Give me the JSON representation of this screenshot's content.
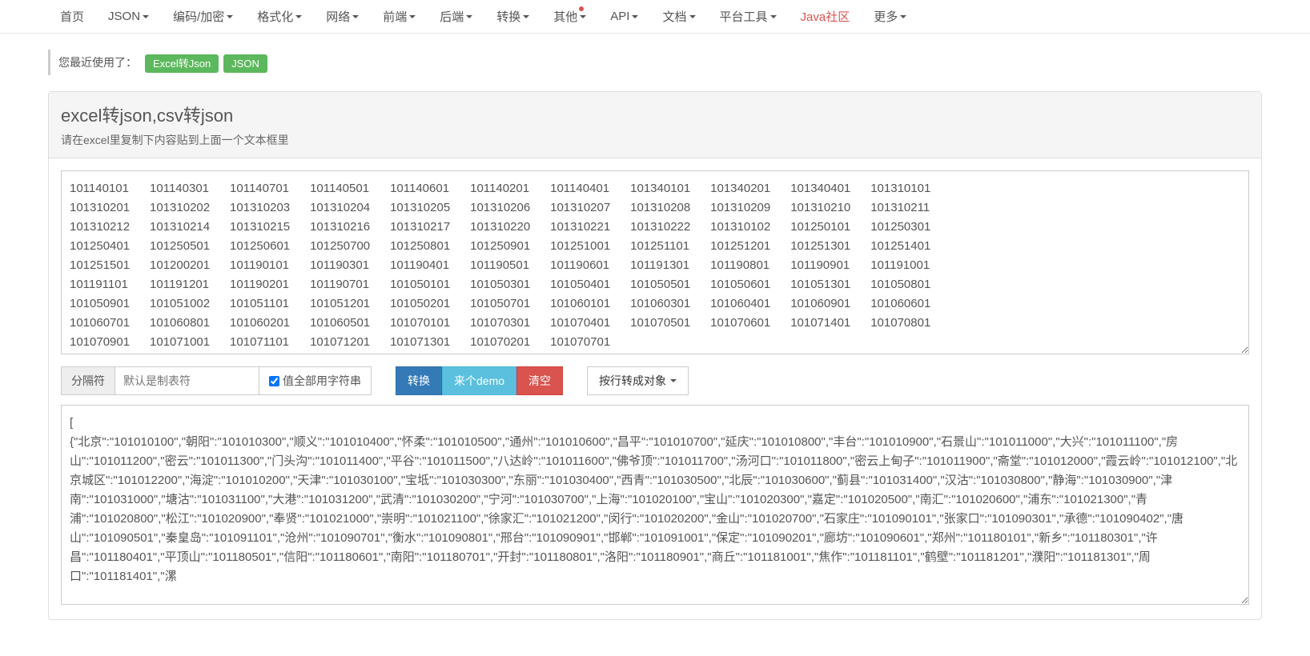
{
  "nav": {
    "items": [
      {
        "label": "首页",
        "dropdown": false
      },
      {
        "label": "JSON",
        "dropdown": true
      },
      {
        "label": "编码/加密",
        "dropdown": true
      },
      {
        "label": "格式化",
        "dropdown": true
      },
      {
        "label": "网络",
        "dropdown": true
      },
      {
        "label": "前端",
        "dropdown": true
      },
      {
        "label": "后端",
        "dropdown": true
      },
      {
        "label": "转换",
        "dropdown": true
      },
      {
        "label": "其他",
        "dropdown": true,
        "badge": true
      },
      {
        "label": "API",
        "dropdown": true
      },
      {
        "label": "文档",
        "dropdown": true
      },
      {
        "label": "平台工具",
        "dropdown": true
      },
      {
        "label": "Java社区",
        "dropdown": false,
        "highlight": true
      },
      {
        "label": "更多",
        "dropdown": true
      }
    ]
  },
  "recent": {
    "label": "您最近使用了：",
    "tags": [
      "Excel转Json",
      "JSON"
    ]
  },
  "panel": {
    "title": "excel转json,csv转json",
    "subtitle": "请在excel里复制下内容贴到上面一个文本框里"
  },
  "input_text": "101140101\t101140301\t101140701\t101140501\t101140601\t101140201\t101140401\t101340101\t101340201\t101340401\t101310101\n101310201\t101310202\t101310203\t101310204\t101310205\t101310206\t101310207\t101310208\t101310209\t101310210\t101310211\n101310212\t101310214\t101310215\t101310216\t101310217\t101310220\t101310221\t101310222\t101310102\t101250101\t101250301\n101250401\t101250501\t101250601\t101250700\t101250801\t101250901\t101251001\t101251101\t101251201\t101251301\t101251401\n101251501\t101200201\t101190101\t101190301\t101190401\t101190501\t101190601\t101191301\t101190801\t101190901\t101191001\n101191101\t101191201\t101190201\t101190701\t101050101\t101050301\t101050401\t101050501\t101050601\t101051301\t101050801\n101050901\t101051002\t101051101\t101051201\t101050201\t101050701\t101060101\t101060301\t101060401\t101060901\t101060601\n101060701\t101060801\t101060201\t101060501\t101070101\t101070301\t101070401\t101070501\t101070601\t101071401\t101070801\n101070901\t101071001\t101071101\t101071201\t101071301\t101070201\t101070701",
  "controls": {
    "separator_label": "分隔符",
    "separator_placeholder": "默认是制表符",
    "checkbox_label": "值全部用字符串",
    "checkbox_checked": true,
    "btn_convert": "转换",
    "btn_demo": "来个demo",
    "btn_clear": "清空",
    "btn_rowobj": "按行转成对象"
  },
  "output_text": "[\n{\"北京\":\"101010100\",\"朝阳\":\"101010300\",\"顺义\":\"101010400\",\"怀柔\":\"101010500\",\"通州\":\"101010600\",\"昌平\":\"101010700\",\"延庆\":\"101010800\",\"丰台\":\"101010900\",\"石景山\":\"101011000\",\"大兴\":\"101011100\",\"房山\":\"101011200\",\"密云\":\"101011300\",\"门头沟\":\"101011400\",\"平谷\":\"101011500\",\"八达岭\":\"101011600\",\"佛爷顶\":\"101011700\",\"汤河口\":\"101011800\",\"密云上甸子\":\"101011900\",\"斋堂\":\"101012000\",\"霞云岭\":\"101012100\",\"北京城区\":\"101012200\",\"海淀\":\"101010200\",\"天津\":\"101030100\",\"宝坻\":\"101030300\",\"东丽\":\"101030400\",\"西青\":\"101030500\",\"北辰\":\"101030600\",\"蓟县\":\"101031400\",\"汉沽\":\"101030800\",\"静海\":\"101030900\",\"津南\":\"101031000\",\"塘沽\":\"101031100\",\"大港\":\"101031200\",\"武清\":\"101030200\",\"宁河\":\"101030700\",\"上海\":\"101020100\",\"宝山\":\"101020300\",\"嘉定\":\"101020500\",\"南汇\":\"101020600\",\"浦东\":\"101021300\",\"青浦\":\"101020800\",\"松江\":\"101020900\",\"奉贤\":\"101021000\",\"崇明\":\"101021100\",\"徐家汇\":\"101021200\",\"闵行\":\"101020200\",\"金山\":\"101020700\",\"石家庄\":\"101090101\",\"张家口\":\"101090301\",\"承德\":\"101090402\",\"唐山\":\"101090501\",\"秦皇岛\":\"101091101\",\"沧州\":\"101090701\",\"衡水\":\"101090801\",\"邢台\":\"101090901\",\"邯郸\":\"101091001\",\"保定\":\"101090201\",\"廊坊\":\"101090601\",\"郑州\":\"101180101\",\"新乡\":\"101180301\",\"许昌\":\"101180401\",\"平顶山\":\"101180501\",\"信阳\":\"101180601\",\"南阳\":\"101180701\",\"开封\":\"101180801\",\"洛阳\":\"101180901\",\"商丘\":\"101181001\",\"焦作\":\"101181101\",\"鹤壁\":\"101181201\",\"濮阳\":\"101181301\",\"周口\":\"101181401\",\"漯"
}
